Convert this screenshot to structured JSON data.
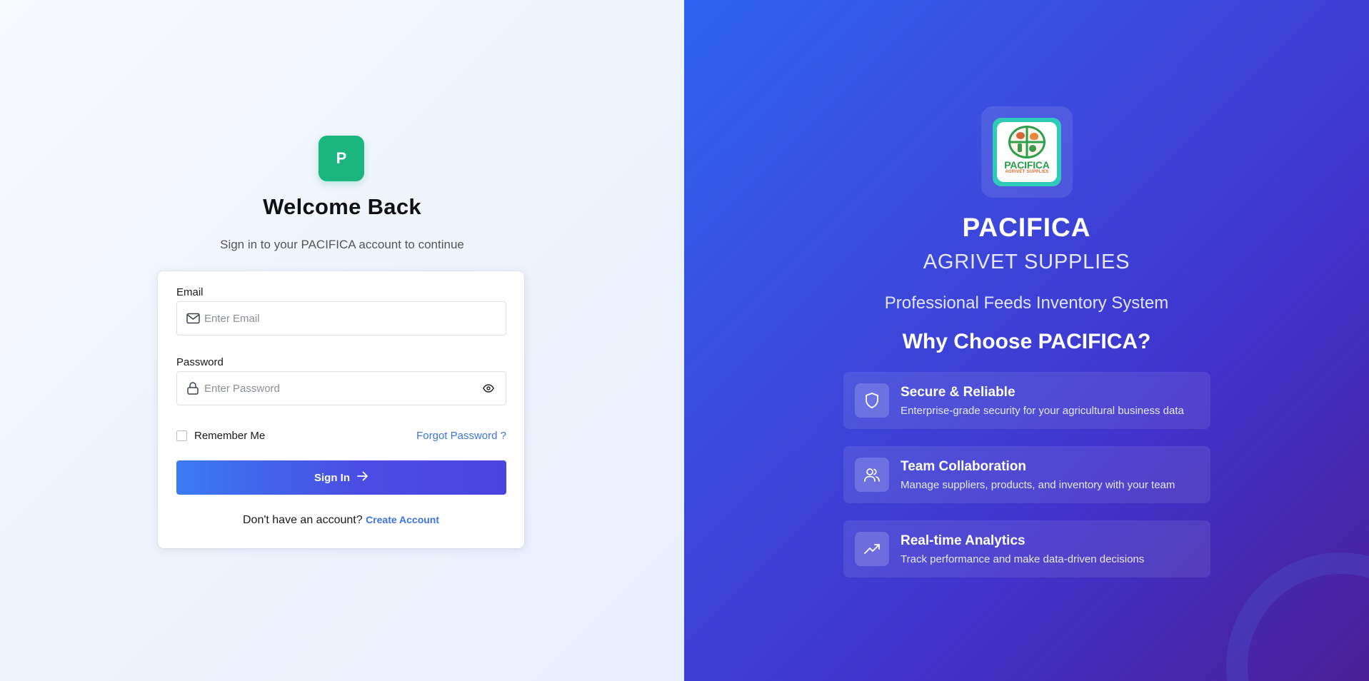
{
  "login": {
    "brand_letter": "P",
    "title": "Welcome Back",
    "subtitle": "Sign in to your PACIFICA account to continue",
    "email_label": "Email",
    "email_placeholder": "Enter Email",
    "password_label": "Password",
    "password_placeholder": "Enter Password",
    "remember_label": "Remember Me",
    "forgot_label": "Forgot Password ?",
    "signin_label": "Sign In",
    "signup_prompt": "Don't have an account?",
    "signup_link": "Create Account"
  },
  "promo": {
    "logo_word": "PACIFICA",
    "logo_sub": "AGRIVET SUPPLIES",
    "brand_title": "PACIFICA",
    "brand_subtitle": "AGRIVET SUPPLIES",
    "tagline": "Professional Feeds Inventory System",
    "why_heading": "Why Choose PACIFICA?",
    "features": [
      {
        "icon": "shield-icon",
        "title": "Secure & Reliable",
        "description": "Enterprise-grade security for your agricultural business data"
      },
      {
        "icon": "users-icon",
        "title": "Team Collaboration",
        "description": "Manage suppliers, products, and inventory with your team"
      },
      {
        "icon": "trending-up-icon",
        "title": "Real-time Analytics",
        "description": "Track performance and make data-driven decisions"
      }
    ]
  },
  "colors": {
    "brand_green": "#1bb57f",
    "link_blue": "#3b74e6",
    "button_gradient_start": "#3a7bf2",
    "button_gradient_end": "#4c44e0",
    "promo_gradient_start": "#2d63ee",
    "promo_gradient_end": "#4a1f96"
  }
}
